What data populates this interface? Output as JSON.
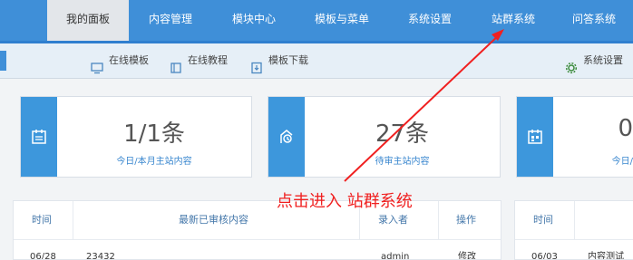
{
  "nav": {
    "items": [
      {
        "label": "我的面板",
        "active": true
      },
      {
        "label": "内容管理",
        "active": false
      },
      {
        "label": "模块中心",
        "active": false
      },
      {
        "label": "模板与菜单",
        "active": false
      },
      {
        "label": "系统设置",
        "active": false
      },
      {
        "label": "站群系统",
        "active": false
      },
      {
        "label": "问答系统",
        "active": false
      }
    ]
  },
  "subbar": {
    "online_template": "在线模板",
    "online_tutorial": "在线教程",
    "template_download": "模板下载",
    "system_settings": "系统设置"
  },
  "cards": [
    {
      "value": "1/1条",
      "caption": "今日/本月主站内容",
      "icon": "calendar-icon"
    },
    {
      "value": "27条",
      "caption": "待审主站内容",
      "icon": "pending-review-icon"
    },
    {
      "value": "0",
      "caption": "今日/",
      "icon": "calendar-grid-icon"
    }
  ],
  "table_left": {
    "headers": [
      "时间",
      "最新已审核内容",
      "录入者",
      "操作"
    ],
    "rows": [
      {
        "date": "06/28",
        "title": "23432",
        "author": "admin",
        "action": "修改"
      }
    ]
  },
  "table_right": {
    "headers": [
      "时间"
    ],
    "rows": [
      {
        "date": "06/03",
        "title": "内容测试"
      }
    ]
  },
  "annotation": {
    "text": "点击进入 站群系统",
    "color": "#f02020"
  },
  "colors": {
    "nav": "#3f8fd8",
    "accent": "#3d97dc",
    "link": "#3a87cf"
  }
}
